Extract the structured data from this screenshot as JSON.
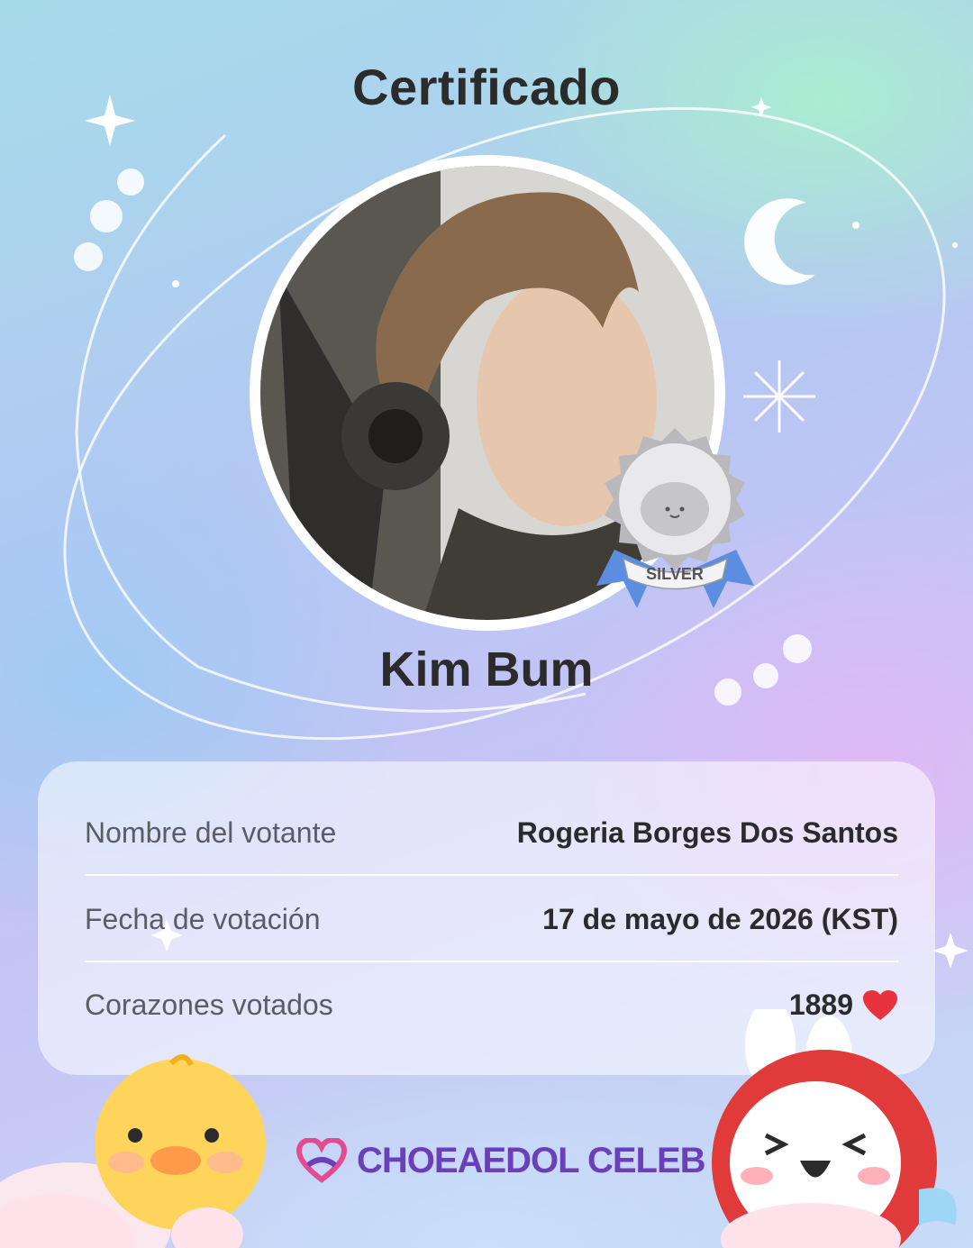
{
  "header": {
    "title": "Certificado"
  },
  "celebrity": {
    "name": "Kim Bum",
    "badge_level": "SILVER"
  },
  "details": {
    "rows": [
      {
        "label": "Nombre del votante",
        "value": "Rogeria Borges Dos Santos"
      },
      {
        "label": "Fecha de votación",
        "value": "17 de mayo de 2026 (KST)"
      },
      {
        "label": "Corazones votados",
        "value": "1889"
      }
    ]
  },
  "brand": {
    "name": "CHOEAEDOL CELEB"
  },
  "colors": {
    "heart": "#e8333f",
    "brand": "#6a3fb8",
    "badge_ribbon": "#5b8ee0",
    "badge_silver": "#c8c8cc"
  }
}
